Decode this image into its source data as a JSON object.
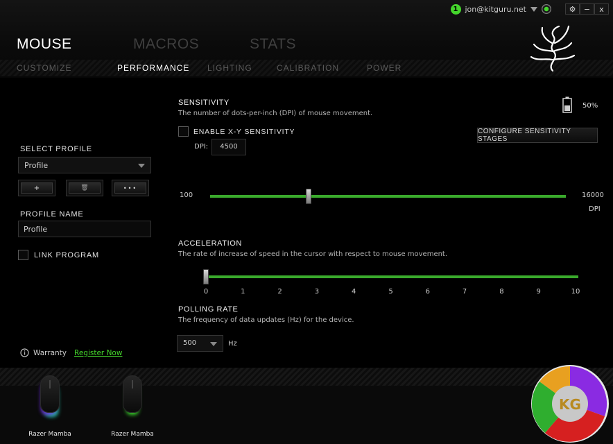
{
  "topbar": {
    "notification_count": "1",
    "user_email": "jon@kitguru.net",
    "settings_label": "⚙",
    "minimize_label": "−",
    "close_label": "x"
  },
  "main_tabs": [
    "MOUSE",
    "MACROS",
    "STATS"
  ],
  "sub_tabs": [
    "CUSTOMIZE",
    "PERFORMANCE",
    "LIGHTING",
    "CALIBRATION",
    "POWER"
  ],
  "left": {
    "select_profile_label": "SELECT PROFILE",
    "profile_selected": "Profile",
    "add_label": "+",
    "delete_label": "🗑",
    "more_label": "•••",
    "profile_name_label": "PROFILE NAME",
    "profile_name_value": "Profile",
    "link_program_label": "LINK PROGRAM",
    "warranty_label": "Warranty",
    "register_label": "Register Now"
  },
  "sensitivity": {
    "title": "SENSITIVITY",
    "description": "The number of dots-per-inch (DPI) of mouse movement.",
    "enable_xy_label": "ENABLE X-Y SENSITIVITY",
    "dpi_label": "DPI:",
    "dpi_value": "4500",
    "configure_label": "CONFIGURE SENSITIVITY STAGES",
    "min_label": "100",
    "max_label": "16000",
    "unit_label": "DPI",
    "value": 4500,
    "min": 100,
    "max": 16000
  },
  "battery": {
    "percent_label": "50%",
    "level": 0.5
  },
  "acceleration": {
    "title": "ACCELERATION",
    "description": "The rate of increase of speed in the cursor with respect to mouse movement.",
    "ticks": [
      "0",
      "1",
      "2",
      "3",
      "4",
      "5",
      "6",
      "7",
      "8",
      "9",
      "10"
    ],
    "value": 0
  },
  "polling": {
    "title": "POLLING RATE",
    "description": "The frequency of data updates (Hz) for the device.",
    "selected": "500",
    "unit": "Hz"
  },
  "devices": [
    {
      "name": "Razer Mamba"
    },
    {
      "name": "Razer Mamba"
    }
  ],
  "colors": {
    "accent": "#44d62c",
    "slider": "#3aa92c"
  }
}
